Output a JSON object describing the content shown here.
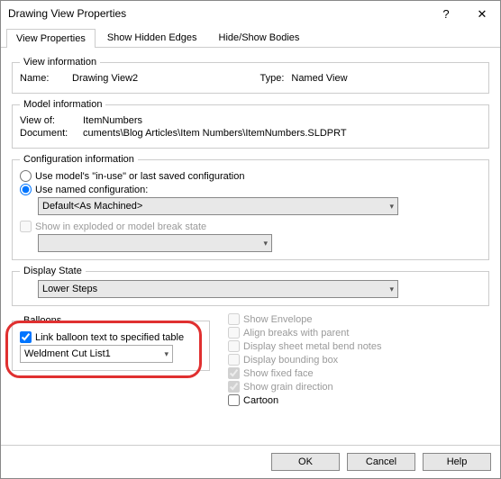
{
  "window": {
    "title": "Drawing View Properties",
    "help_symbol": "?",
    "close_symbol": "✕"
  },
  "tabs": {
    "view_properties": "View Properties",
    "show_hidden_edges": "Show Hidden Edges",
    "hide_show_bodies": "Hide/Show Bodies"
  },
  "view_info": {
    "legend": "View information",
    "name_label": "Name:",
    "name_value": "Drawing View2",
    "type_label": "Type:",
    "type_value": "Named View"
  },
  "model_info": {
    "legend": "Model information",
    "view_of_label": "View of:",
    "view_of_value": "ItemNumbers",
    "document_label": "Document:",
    "document_value": "cuments\\Blog Articles\\Item Numbers\\ItemNumbers.SLDPRT"
  },
  "config_info": {
    "legend": "Configuration information",
    "radio_inuse": "Use model's \"in-use\" or last saved configuration",
    "radio_named": "Use named configuration:",
    "named_value": "Default<As Machined>",
    "exploded_label": "Show in exploded or model break state"
  },
  "display_state": {
    "legend": "Display State",
    "value": "Lower Steps"
  },
  "balloons": {
    "legend": "Balloons",
    "link_label": "Link balloon text to specified table",
    "table_value": "Weldment Cut List1"
  },
  "opts": {
    "show_envelope": "Show Envelope",
    "align_breaks": "Align breaks with parent",
    "display_bend": "Display sheet metal bend notes",
    "display_bbox": "Display bounding box",
    "show_fixed_face": "Show fixed face",
    "show_grain": "Show grain direction",
    "cartoon": "Cartoon"
  },
  "buttons": {
    "ok": "OK",
    "cancel": "Cancel",
    "help": "Help"
  }
}
